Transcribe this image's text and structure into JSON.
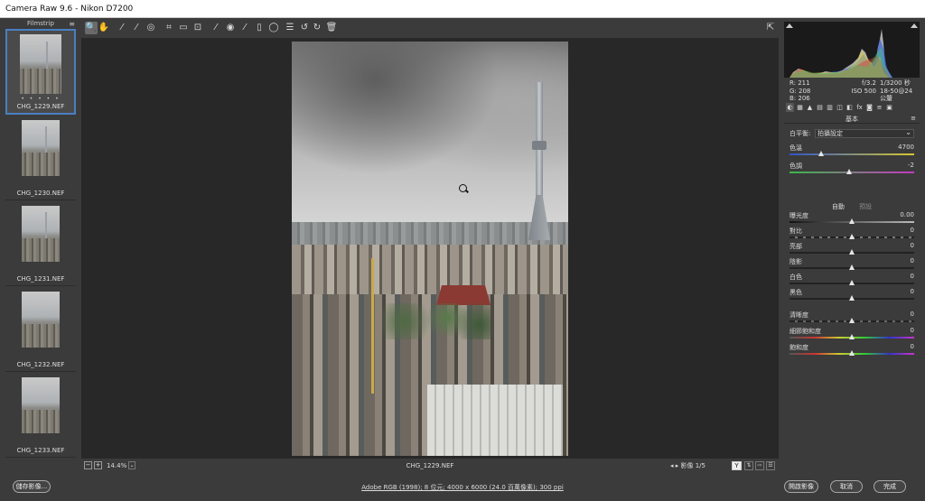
{
  "window": {
    "title": "Camera Raw 9.6  -  Nikon D7200"
  },
  "filmstrip": {
    "header": "Filmstrip",
    "menu_icon": "≡",
    "items": [
      {
        "name": "CHG_1229.NEF",
        "rating": "• • • • •",
        "selected": true
      },
      {
        "name": "CHG_1230.NEF",
        "selected": false
      },
      {
        "name": "CHG_1231.NEF",
        "selected": false
      },
      {
        "name": "CHG_1232.NEF",
        "selected": false
      },
      {
        "name": "CHG_1233.NEF",
        "selected": false
      }
    ]
  },
  "toolbar": {
    "tools": [
      {
        "name": "zoom-tool-icon",
        "glyph": "🔍",
        "active": true
      },
      {
        "name": "hand-tool-icon",
        "glyph": "✋"
      },
      {
        "name": "white-balance-tool-icon",
        "glyph": "⁄"
      },
      {
        "name": "color-sampler-tool-icon",
        "glyph": "⁄"
      },
      {
        "name": "targeted-adjustment-tool-icon",
        "glyph": "◎"
      },
      {
        "name": "crop-tool-icon",
        "glyph": "⌗"
      },
      {
        "name": "straighten-tool-icon",
        "glyph": "▭"
      },
      {
        "name": "transform-tool-icon",
        "glyph": "⊡"
      },
      {
        "name": "spot-removal-tool-icon",
        "glyph": "⁄"
      },
      {
        "name": "red-eye-tool-icon",
        "glyph": "◉"
      },
      {
        "name": "adjustment-brush-icon",
        "glyph": "⁄"
      },
      {
        "name": "graduated-filter-icon",
        "glyph": "▯"
      },
      {
        "name": "radial-filter-icon",
        "glyph": "◯"
      },
      {
        "name": "preferences-icon",
        "glyph": "☰"
      },
      {
        "name": "rotate-ccw-icon",
        "glyph": "↺"
      },
      {
        "name": "rotate-cw-icon",
        "glyph": "↻"
      },
      {
        "name": "trash-icon",
        "glyph": "🗑"
      }
    ],
    "fullscreen_glyph": "⇱"
  },
  "preview": {
    "zoom": "14.4%",
    "filename": "CHG_1229.NEF",
    "nav": "◂  ▸  影像 1/5",
    "y_button": "Y"
  },
  "histogram": {
    "r": "R:   211",
    "g": "G:   208",
    "b": "B:   206",
    "aperture": "f/3.2",
    "shutter": "1/3200 秒",
    "iso": "ISO 500",
    "lens": "18-50@24 公釐"
  },
  "panel": {
    "tab_icons": [
      "◐",
      "▦",
      "▲",
      "▤",
      "▥",
      "◫",
      "◧",
      "fx",
      "◙",
      "≡",
      "▣"
    ],
    "section_title": "基本",
    "white_balance_label": "白平衡:",
    "white_balance_value": "拍攝設定",
    "temp": {
      "label": "色溫",
      "value": "4700",
      "position": 0.25
    },
    "tint": {
      "label": "色調",
      "value": "-2",
      "position": 0.48
    },
    "auto_label": "自動",
    "default_label": "預設",
    "sliders": [
      {
        "label": "曝光度",
        "value": "0.00",
        "position": 0.5
      },
      {
        "label": "對比",
        "value": "0",
        "position": 0.5
      },
      {
        "label": "亮部",
        "value": "0",
        "position": 0.5
      },
      {
        "label": "陰影",
        "value": "0",
        "position": 0.5
      },
      {
        "label": "白色",
        "value": "0",
        "position": 0.5
      },
      {
        "label": "黑色",
        "value": "0",
        "position": 0.5
      }
    ],
    "presence": [
      {
        "label": "清晰度",
        "value": "0",
        "position": 0.5
      },
      {
        "label": "細節飽和度",
        "value": "0",
        "position": 0.5
      },
      {
        "label": "飽和度",
        "value": "0",
        "position": 0.5
      }
    ]
  },
  "bottom": {
    "save_button": "儲存影像...",
    "workflow_link": "Adobe RGB (1998); 8 位元; 4000 x 6000 (24.0 百萬像素); 300 ppi",
    "open_button": "開啟影像",
    "cancel_button": "取消",
    "done_button": "完成"
  },
  "colors": {
    "selection": "#4a7ec4",
    "panel": "#3b3b3b",
    "preview_bg": "#282828"
  }
}
